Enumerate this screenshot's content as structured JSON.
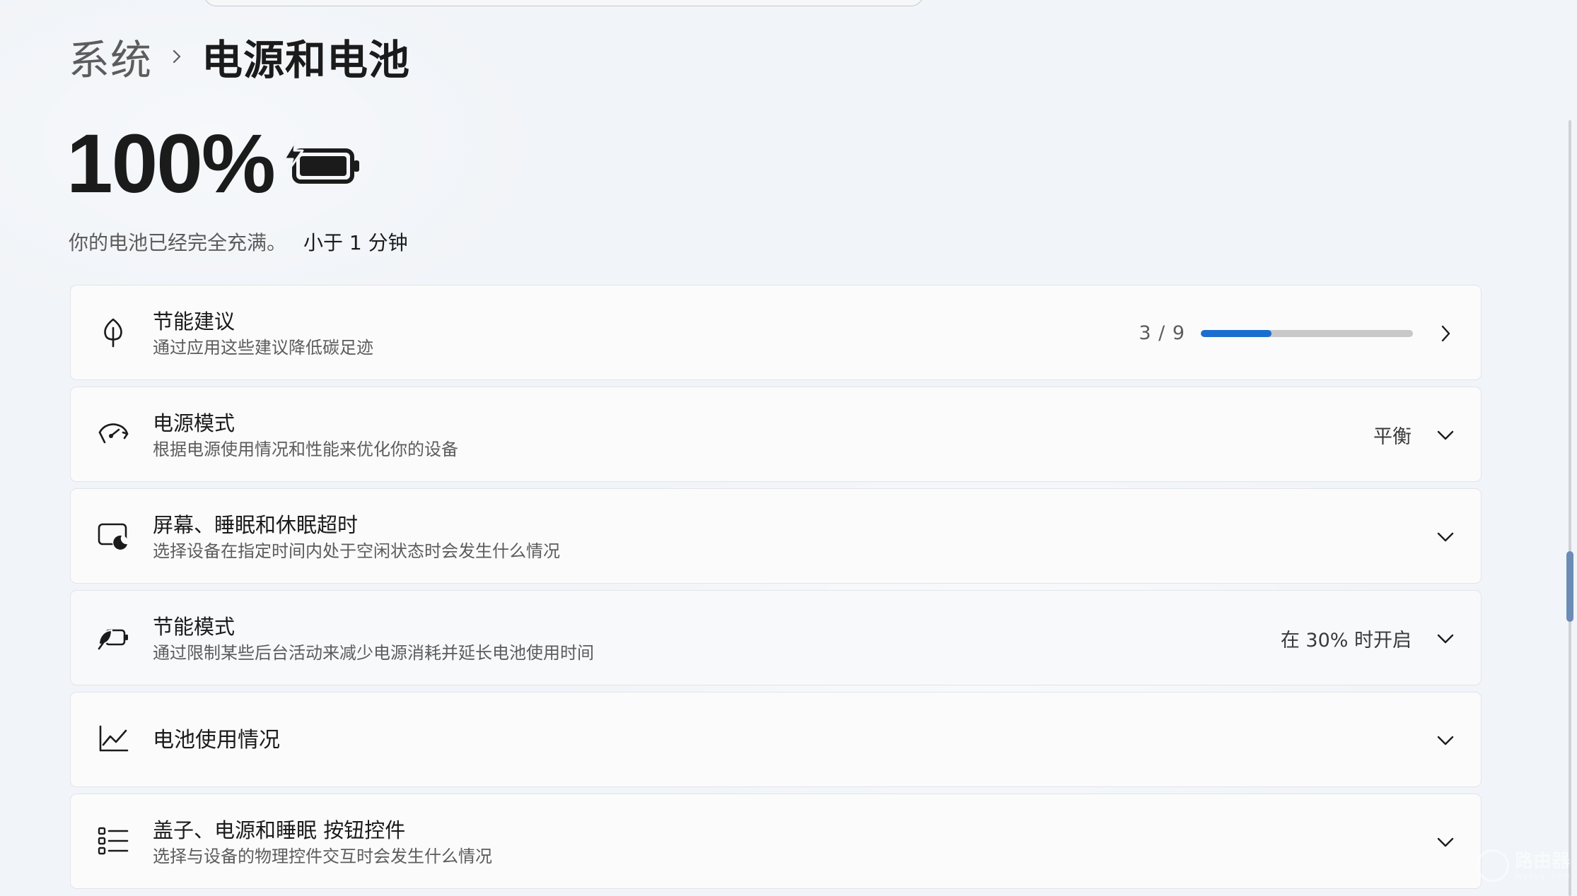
{
  "breadcrumb": {
    "parent": "系统",
    "current": "电源和电池"
  },
  "battery": {
    "percent": "100%",
    "status_text": "你的电池已经完全充满。",
    "time_text": "小于 1 分钟"
  },
  "cards": [
    {
      "id": "energy-recommendations",
      "title": "节能建议",
      "subtitle": "通过应用这些建议降低碳足迹",
      "icon": "leaf-icon",
      "progress_text": "3 / 9",
      "progress_done": 3,
      "progress_total": 9,
      "action": "chevron-right-icon"
    },
    {
      "id": "power-mode",
      "title": "电源模式",
      "subtitle": "根据电源使用情况和性能来优化你的设备",
      "icon": "speedometer-icon",
      "value": "平衡",
      "action": "chevron-down-icon"
    },
    {
      "id": "screen-sleep",
      "title": "屏幕、睡眠和休眠超时",
      "subtitle": "选择设备在指定时间内处于空闲状态时会发生什么情况",
      "icon": "screen-sleep-icon",
      "action": "chevron-down-icon"
    },
    {
      "id": "battery-saver",
      "title": "节能模式",
      "subtitle": "通过限制某些后台活动来减少电源消耗并延长电池使用时间",
      "icon": "battery-saver-icon",
      "value": "在 30% 时开启",
      "action": "chevron-down-icon"
    },
    {
      "id": "battery-usage",
      "title": "电池使用情况",
      "icon": "chart-line-icon",
      "action": "chevron-down-icon"
    },
    {
      "id": "lid-power-buttons",
      "title": "盖子、电源和睡眠 按钮控件",
      "subtitle": "选择与设备的物理控件交互时会发生什么情况",
      "icon": "list-controls-icon",
      "action": "chevron-down-icon"
    }
  ],
  "colors": {
    "accent": "#1a6fce",
    "track": "#c8c8c8",
    "background": "#f1f4f8",
    "card": "#fbfbfc"
  },
  "watermark": {
    "text": "路由器",
    "sub": "luyouqi.com"
  }
}
